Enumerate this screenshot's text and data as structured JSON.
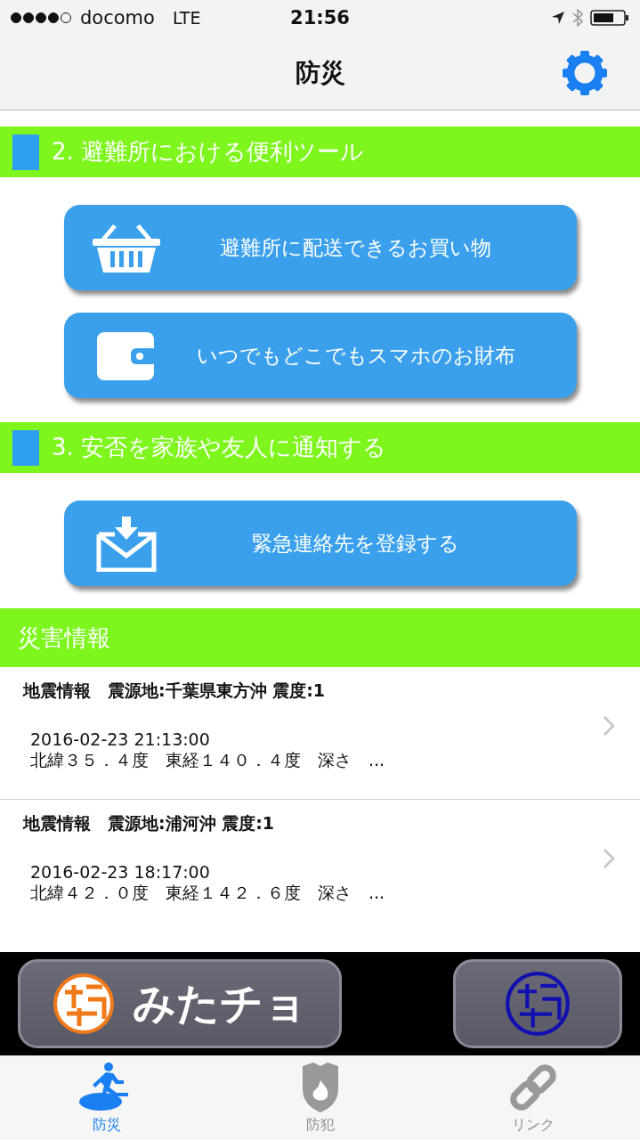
{
  "status_bar": {
    "carrier": "docomo",
    "network": "LTE",
    "time": "21:56",
    "signal_bars": [
      true,
      true,
      true,
      true,
      false
    ]
  },
  "nav": {
    "title": "防災"
  },
  "sections": [
    {
      "title": "2. 避難所における便利ツール",
      "buttons": [
        {
          "kind": "basket",
          "label": "避難所に配送できるお買い物"
        },
        {
          "kind": "wallet",
          "label": "いつでもどこでもスマホのお財布"
        }
      ]
    },
    {
      "title": "3. 安否を家族や友人に通知する",
      "buttons": [
        {
          "kind": "mail",
          "label": "緊急連絡先を登録する"
        }
      ]
    }
  ],
  "disaster": {
    "title": "災害情報",
    "items": [
      {
        "headline": "地震情報　震源地:千葉県東方沖 震度:1",
        "time": "2016-02-23 21:13:00",
        "detail": "北緯３５．４度　東経１４０．４度　深さ　..."
      },
      {
        "headline": "地震情報　震源地:浦河沖 震度:1",
        "time": "2016-02-23 18:17:00",
        "detail": "北緯４２．０度　東経１４２．６度　深さ　..."
      }
    ]
  },
  "banner": {
    "label": "みたチョ"
  },
  "tabs": [
    {
      "kind": "runner",
      "label": "防災",
      "selected": true
    },
    {
      "kind": "shield",
      "label": "防犯",
      "selected": false
    },
    {
      "kind": "link",
      "label": "リンク",
      "selected": false
    }
  ]
}
